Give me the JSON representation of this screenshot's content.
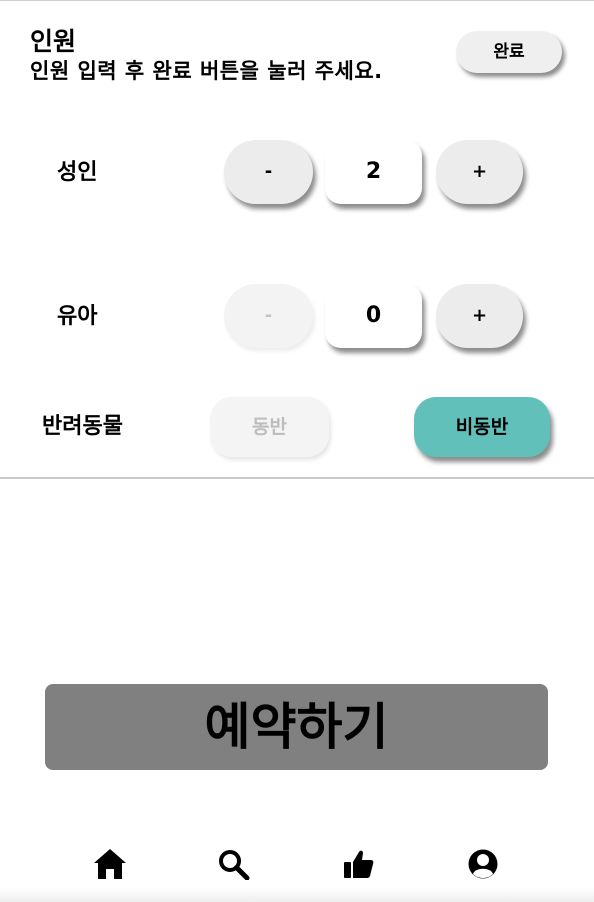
{
  "header": {
    "title": "인원",
    "subtitle": "인원 입력 후 완료 버튼을 눌러 주세요.",
    "done_label": "완료"
  },
  "adult": {
    "label": "성인",
    "minus": "-",
    "value": "2",
    "plus": "+"
  },
  "infant": {
    "label": "유아",
    "minus": "-",
    "value": "0",
    "plus": "+"
  },
  "pet": {
    "label": "반려동물",
    "with_label": "동반",
    "without_label": "비동반",
    "selected": "비동반",
    "accent_color": "#62c0ba"
  },
  "reserve": {
    "label": "예약하기"
  },
  "nav": {
    "items": [
      {
        "icon": "home-icon"
      },
      {
        "icon": "search-icon"
      },
      {
        "icon": "thumbs-up-icon"
      },
      {
        "icon": "profile-icon"
      }
    ]
  }
}
